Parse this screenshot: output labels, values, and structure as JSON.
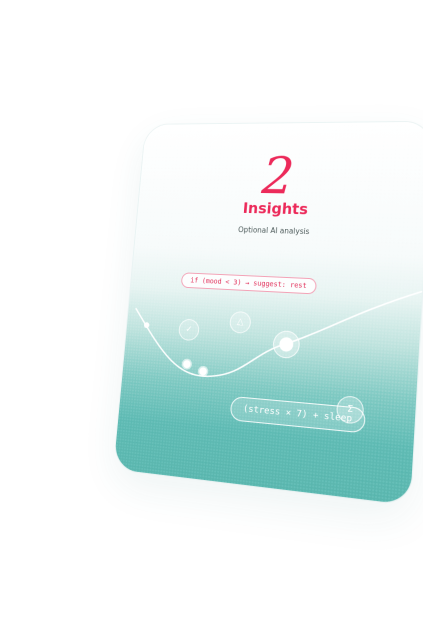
{
  "card": {
    "number": "2",
    "title": "Insights",
    "subtitle": "Optional AI analysis",
    "code_pill": "if (mood < 3) → suggest: rest",
    "formula_pill": "(stress × 7) + sleep"
  },
  "icons": {
    "check": "check-icon",
    "triangle": "triangle-icon",
    "sigma": "sigma-icon"
  },
  "colors": {
    "accent": "#ec2a5a",
    "teal": "#5bb6ae"
  }
}
